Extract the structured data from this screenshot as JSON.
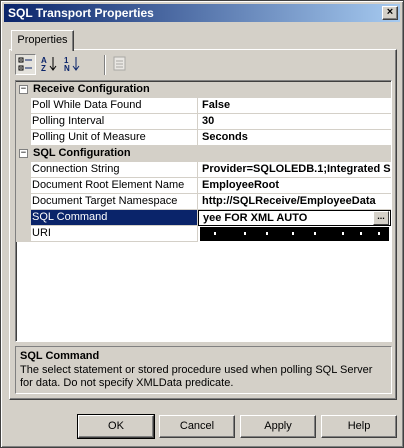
{
  "window": {
    "title": "SQL Transport Properties",
    "close_glyph": "×"
  },
  "tabs": [
    {
      "label": "Properties"
    }
  ],
  "toolbar": {
    "buttons": [
      {
        "icon": "categorized-icon",
        "pressed": true
      },
      {
        "icon": "alphabetical-icon",
        "pressed": false
      },
      {
        "icon": "sort-numeric-icon",
        "pressed": false
      },
      {
        "icon": "property-pages-icon",
        "pressed": false
      }
    ]
  },
  "grid": {
    "categories": [
      {
        "label": "Receive Configuration",
        "expander": "−",
        "properties": [
          {
            "name": "Poll While Data Found",
            "value": "False"
          },
          {
            "name": "Polling Interval",
            "value": "30"
          },
          {
            "name": "Polling Unit of Measure",
            "value": "Seconds"
          }
        ]
      },
      {
        "label": "SQL Configuration",
        "expander": "−",
        "properties": [
          {
            "name": "Connection String",
            "value": "Provider=SQLOLEDB.1;Integrated S"
          },
          {
            "name": "Document Root Element Name",
            "value": "EmployeeRoot"
          },
          {
            "name": "Document Target Namespace",
            "value": "http://SQLReceive/EmployeeData"
          },
          {
            "name": "SQL Command",
            "value": "yee  FOR XML AUTO",
            "selected": true,
            "ellipsis": "..."
          },
          {
            "name": "URI",
            "value": "",
            "masked": true
          }
        ]
      }
    ]
  },
  "description": {
    "title": "SQL Command",
    "text": "The select statement or stored procedure used when polling SQL Server for data. Do not specify XMLData predicate."
  },
  "buttons": {
    "ok": "OK",
    "cancel": "Cancel",
    "apply": "Apply",
    "help": "Help"
  },
  "colors": {
    "titlebar": "#0a246a",
    "selection": "#0a246a",
    "face": "#d4d0c8"
  }
}
